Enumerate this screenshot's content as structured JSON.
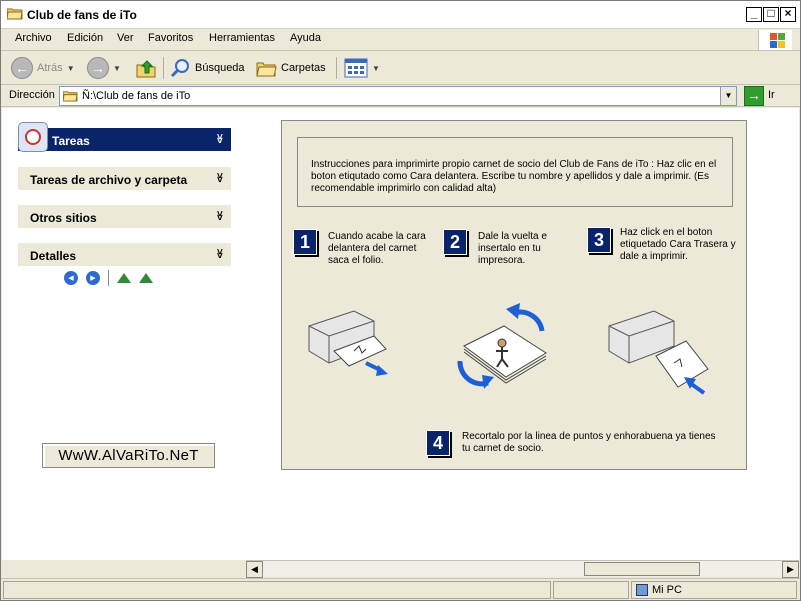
{
  "window": {
    "title": "Club de fans de iTo"
  },
  "menu": [
    "Archivo",
    "Edición",
    "Ver",
    "Favoritos",
    "Herramientas",
    "Ayuda"
  ],
  "toolbar": {
    "back": "Atrás",
    "search": "Búsqueda",
    "folders": "Carpetas"
  },
  "address": {
    "label": "Dirección",
    "value": "Ñ:\\Club de fans de iTo",
    "go": "Ir"
  },
  "panes": {
    "tasks": "Tareas",
    "file_tasks": "Tareas de archivo y carpeta",
    "other_places": "Otros sitios",
    "details": "Detalles"
  },
  "site_label": "WwW.AlVaRiTo.NeT",
  "card": {
    "intro": "Instrucciones para imprimirte propio carnet de socio del Club de Fans  de  iTo : Haz clic en el boton etiqutado como Cara delantera. Escribe tu nombre y apellidos y dale a imprimir. (Es recomendable imprimirlo con calidad alta)",
    "steps": [
      {
        "n": "1",
        "text": "Cuando acabe la cara delantera del carnet saca el folio."
      },
      {
        "n": "2",
        "text": "Dale la vuelta e insertalo en tu impresora."
      },
      {
        "n": "3",
        "text": "Haz click en el boton etiquetado  Cara Trasera y dale a imprimir."
      },
      {
        "n": "4",
        "text": "Recortalo por la linea de puntos y enhorabuena ya tienes tu carnet de socio."
      }
    ]
  },
  "status": {
    "location": "Mi PC"
  },
  "colors": {
    "task_header": "#0a246a",
    "step_box": "#0a246a",
    "arrow_blue": "#1e5fd6",
    "chrome": "#ECE9D8"
  }
}
